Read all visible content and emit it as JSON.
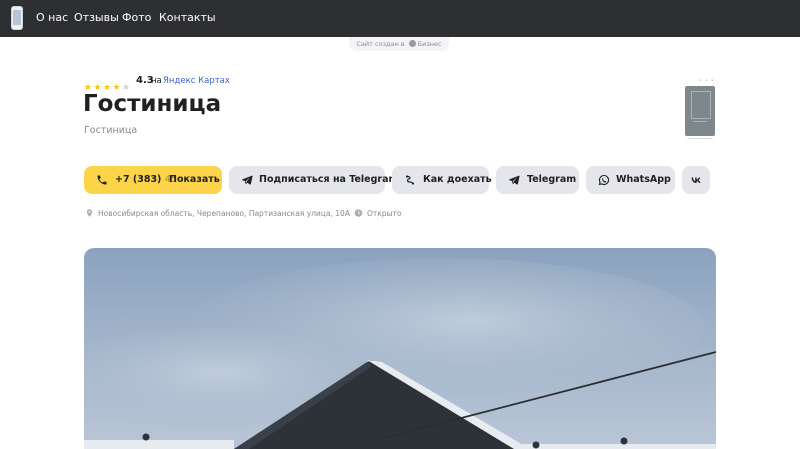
{
  "nav": {
    "items": [
      {
        "label": "О нас"
      },
      {
        "label": "Отзывы"
      },
      {
        "label": "Фото"
      },
      {
        "label": "Контакты"
      }
    ]
  },
  "made_with": {
    "prefix": "Сайт создан в",
    "brand": "Бизнес"
  },
  "rating": {
    "value": "4.3",
    "stars": 4.3,
    "on_label": "на",
    "source_link": "Яндекс Картах"
  },
  "business": {
    "name": "Гостиница",
    "category": "Гостиница"
  },
  "actions": {
    "call": {
      "phone_visible": "+7 (383)",
      "phone_fade": "45",
      "show_label": "Показать"
    },
    "subscribe_telegram": "Подписаться на Telegram",
    "route": "Как доехать",
    "telegram": "Telegram",
    "whatsapp": "WhatsApp"
  },
  "info": {
    "address": "Новосибирская область, Черепаново, Партизанская улица, 10А",
    "status": "Открыто"
  },
  "colors": {
    "topbar": "#2e2f33",
    "accent_yellow": "#fbd449",
    "button_gray": "#e4e6eb",
    "link_blue": "#3d64c7",
    "star": "#fbc21a"
  },
  "icons": {
    "subscribe": "telegram-icon",
    "route": "route-icon",
    "telegram": "telegram-icon",
    "whatsapp": "whatsapp-icon",
    "vk": "vk-icon",
    "address": "map-pin-icon",
    "status": "clock-icon"
  }
}
